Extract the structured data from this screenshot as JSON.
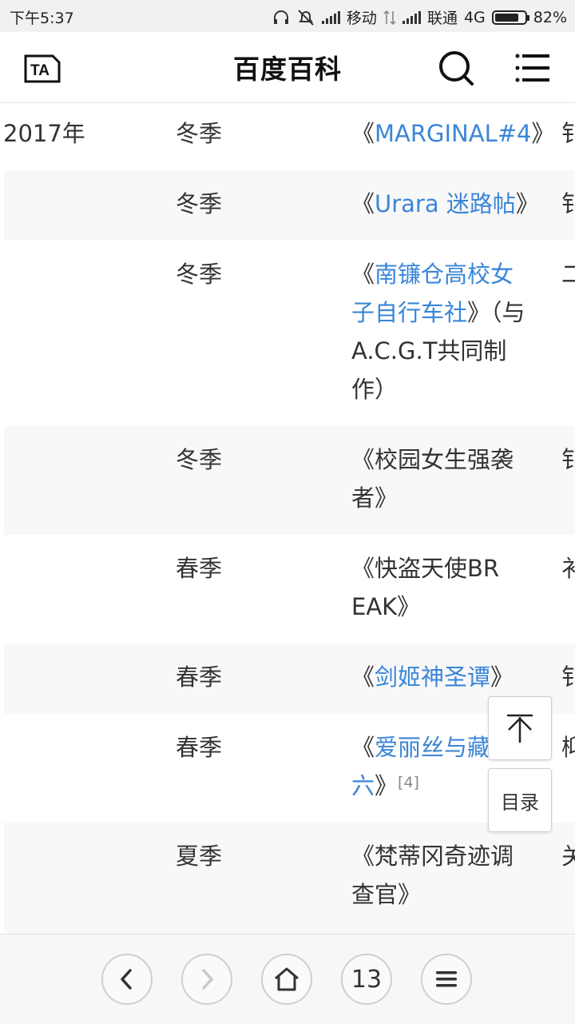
{
  "status": {
    "time": "下午5:37",
    "carrier1": "移动",
    "carrier2": "联通",
    "network": "4G",
    "battery": "82%",
    "battery_level": 0.82
  },
  "header": {
    "title": "百度百科",
    "ta_icon": "TA",
    "search_icon": "search-icon",
    "menu_icon": "menu-icon"
  },
  "table": {
    "rows": [
      {
        "year": "2017年",
        "season": "冬季",
        "title_pre": "《",
        "title_link": "MARGINAL#4",
        "title_post": "》",
        "title_extra": "",
        "ref": "",
        "extra": "钅"
      },
      {
        "year": "",
        "season": "冬季",
        "title_pre": "《",
        "title_link": "Urara 迷路帖",
        "title_post": "》",
        "title_extra": "",
        "ref": "",
        "extra": "钅"
      },
      {
        "year": "",
        "season": "冬季",
        "title_pre": "《",
        "title_link": "南镰仓高校女子自行车社",
        "title_post": "》",
        "title_extra": "（与A.C.G.T共同制作）",
        "ref": "",
        "extra": "二"
      },
      {
        "year": "",
        "season": "冬季",
        "title_pre": "《",
        "title_link": "",
        "title_post": "校园女生强袭者》",
        "title_extra": "",
        "ref": "",
        "extra": "钅"
      },
      {
        "year": "",
        "season": "春季",
        "title_pre": "《",
        "title_link": "",
        "title_post": "快盗天使BREAK》",
        "title_extra": "",
        "ref": "",
        "extra": "衤"
      },
      {
        "year": "",
        "season": "春季",
        "title_pre": "《",
        "title_link": "剑姬神圣谭",
        "title_post": "》",
        "title_extra": "",
        "ref": "",
        "extra": "钅"
      },
      {
        "year": "",
        "season": "春季",
        "title_pre": "《",
        "title_link": "爱丽丝与藏六",
        "title_post": "》",
        "title_extra": "",
        "ref": "[4]",
        "extra": "枊"
      },
      {
        "year": "",
        "season": "夏季",
        "title_pre": "《",
        "title_link": "",
        "title_post": "梵蒂冈奇迹调查官》",
        "title_extra": "",
        "ref": "",
        "extra": "关"
      }
    ]
  },
  "floating": {
    "top_icon": "arrow-up-icon",
    "toc_label": "目录"
  },
  "bottom": {
    "page_count": "13",
    "back_icon": "chevron-left-icon",
    "forward_icon": "chevron-right-icon",
    "home_icon": "home-icon",
    "menu_icon": "hamburger-icon"
  }
}
